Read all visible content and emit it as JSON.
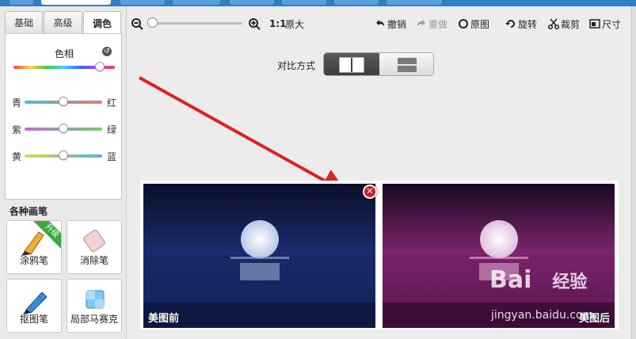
{
  "tabs": [
    {
      "label": "基础",
      "active": false
    },
    {
      "label": "高级",
      "active": false
    },
    {
      "label": "调色",
      "active": true
    }
  ],
  "color_panel": {
    "hue_label": "色相",
    "sliders": [
      {
        "left": "青",
        "right": "红",
        "value": 0.5
      },
      {
        "left": "紫",
        "right": "绿",
        "value": 0.5
      },
      {
        "left": "黄",
        "right": "蓝",
        "value": 0.5
      }
    ],
    "hue_value": 0.85
  },
  "brushes": {
    "title": "各种画笔",
    "items": [
      {
        "label": "涂鸦笔",
        "badge": "升级"
      },
      {
        "label": "消除笔"
      },
      {
        "label": "抠图笔"
      },
      {
        "label": "局部马赛克"
      }
    ]
  },
  "toolbar": {
    "zoom_ratio": "1:1",
    "original_size": "原大",
    "undo": "撤销",
    "redo": "重做",
    "original": "原图",
    "rotate": "旋转",
    "crop": "裁剪",
    "size": "尺寸",
    "zoom_value": 0
  },
  "compare": {
    "label": "对比方式",
    "mode": "side-by-side"
  },
  "photos": {
    "before": "美图前",
    "after": "美图后"
  },
  "watermark": {
    "brand": "Bai",
    "brand2": "经验",
    "site": "jingyan.baidu.com"
  },
  "colors": {
    "accent_blue": "#2f7fc6",
    "arrow_red": "#e02020",
    "close_red": "#c8202a"
  }
}
